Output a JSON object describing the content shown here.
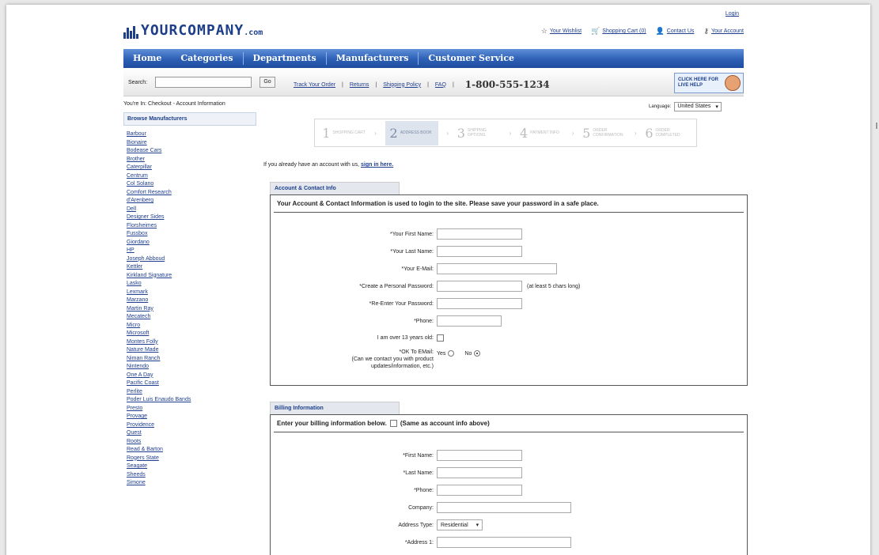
{
  "header": {
    "login": "Login",
    "logo_main": "YOURCOMPANY",
    "logo_domain": ".com",
    "links": [
      {
        "icon": "star-icon",
        "glyph": "☆",
        "label": "Your Wishlist"
      },
      {
        "icon": "cart-icon",
        "glyph": "🛒",
        "label": "Shopping Cart (0)"
      },
      {
        "icon": "contact-icon",
        "glyph": "👤",
        "label": "Contact Us"
      },
      {
        "icon": "key-icon",
        "glyph": "⚷",
        "label": "Your Account"
      }
    ]
  },
  "nav": [
    "Home",
    "Categories",
    "Departments",
    "Manufacturers",
    "Customer Service"
  ],
  "searchbar": {
    "label": "Search:",
    "go": "Go",
    "links": [
      "Track Your Order",
      "Returns",
      "Shipping Policy",
      "FAQ"
    ],
    "phone": "1-800-555-1234",
    "live_help": "CLICK HERE FOR LIVE HELP"
  },
  "breadcrumb": "You're In: Checkout - Account Information",
  "language": {
    "label": "Language:",
    "value": "United States"
  },
  "sidebar": {
    "title": "Browse Manufacturers",
    "items": [
      "Barbour",
      "Bionaire",
      "Bodease Cars",
      "Brother",
      "Caterpillar",
      "Centrum",
      "Col Solano",
      "Comfort Research",
      "d'Arenberg",
      "Dell",
      "Designer Sides",
      "Florsheimes",
      "Fussbox",
      "Giordano",
      "HP",
      "Joseph Abboud",
      "Kettler",
      "Kirkland Signature",
      "Lasko",
      "Lexmark",
      "Marzano",
      "Martin Ray",
      "Mecatech",
      "Micro",
      "Microsoft",
      "Montes Folly",
      "Nature Made",
      "Niman Ranch",
      "Nintendo",
      "One A Day",
      "Pacific Coast",
      "Perlite",
      "Poder Luis Enaudo Bands",
      "Presto",
      "Provage",
      "Providence",
      "Quest",
      "Roots",
      "Read & Barton",
      "Rogers State",
      "Seagate",
      "Sheeds",
      "Simone"
    ]
  },
  "steps": [
    {
      "num": "1",
      "label": "Shopping Cart"
    },
    {
      "num": "2",
      "label": "Address Book"
    },
    {
      "num": "3",
      "label": "Shipping Options"
    },
    {
      "num": "4",
      "label": "Payment Info"
    },
    {
      "num": "5",
      "label": "Order Confirmation"
    },
    {
      "num": "6",
      "label": "Order Completed"
    }
  ],
  "active_step": "2",
  "signin": {
    "text": "If you already have an account with us,",
    "link": "sign in here."
  },
  "account": {
    "tab": "Account & Contact Info",
    "heading": "Your Account & Contact Information is used to login to the site. Please save your password in a safe place.",
    "fields": {
      "first": "*Your First Name:",
      "last": "*Your Last Name:",
      "email": "*Your E-Mail:",
      "password": "*Create a Personal Password:",
      "password_note": "(at least 5 chars long)",
      "reenter": "*Re-Enter Your Password:",
      "phone": "*Phone:",
      "age": "I am over 13 years old:",
      "ok_email": "*OK To EMail:",
      "ok_email_sub": "(Can we contact you with product updates/information, etc.)",
      "yes": "Yes",
      "no": "No"
    }
  },
  "billing": {
    "tab": "Billing Information",
    "heading": "Enter your billing information below.",
    "same": "(Same as account info above)",
    "fields": {
      "first": "*First Name:",
      "last": "*Last Name:",
      "phone": "*Phone:",
      "company": "Company:",
      "address_type": "Address Type:",
      "address_type_value": "Residential",
      "address1": "*Address 1:"
    }
  }
}
